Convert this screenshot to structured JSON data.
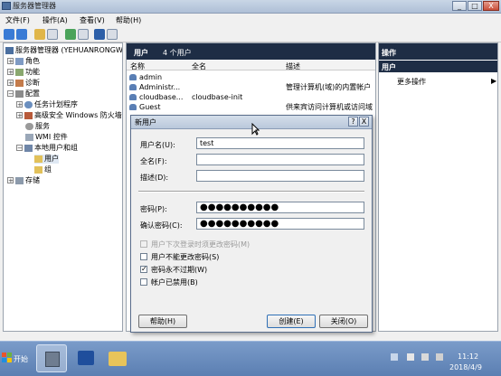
{
  "window": {
    "title": "服务器管理器",
    "controls": [
      "_",
      "□",
      "X"
    ]
  },
  "menu": [
    "文件(F)",
    "操作(A)",
    "查看(V)",
    "帮助(H)"
  ],
  "tree": {
    "root": "服务器管理器 (YEHUANRONGWING",
    "items": [
      "角色",
      "功能",
      "诊断",
      "配置",
      "任务计划程序",
      "高级安全 Windows 防火墙",
      "服务",
      "WMI 控件",
      "本地用户和组",
      "用户",
      "组",
      "存储"
    ]
  },
  "users_pane": {
    "header": "用户",
    "count": "4 个用户",
    "columns": [
      "名称",
      "全名",
      "描述"
    ],
    "rows": [
      {
        "name": "admin",
        "fullname": "",
        "desc": ""
      },
      {
        "name": "Administr...",
        "fullname": "",
        "desc": "管理计算机(域)的内置帐户"
      },
      {
        "name": "cloudbase...",
        "fullname": "cloudbase-init",
        "desc": ""
      },
      {
        "name": "Guest",
        "fullname": "",
        "desc": "供来宾访问计算机或访问域"
      }
    ]
  },
  "actions": {
    "header": "操作",
    "sub": "用户",
    "more": "更多操作",
    "arrow": "▶"
  },
  "dialog": {
    "title": "新用户",
    "help_btn": "?",
    "close_btn": "X",
    "username_label": "用户名(U):",
    "username_value": "test",
    "fullname_label": "全名(F):",
    "fullname_value": "",
    "desc_label": "描述(D):",
    "desc_value": "",
    "password_label": "密码(P):",
    "password_value": "●●●●●●●●●●",
    "confirm_label": "确认密码(C):",
    "confirm_value": "●●●●●●●●●●",
    "checks": [
      {
        "label": "用户下次登录时须更改密码(M)",
        "checked": false,
        "disabled": true,
        "mark": ""
      },
      {
        "label": "用户不能更改密码(S)",
        "checked": false,
        "disabled": false,
        "mark": ""
      },
      {
        "label": "密码永不过期(W)",
        "checked": true,
        "disabled": false,
        "mark": "✓"
      },
      {
        "label": "帐户已禁用(B)",
        "checked": false,
        "disabled": false,
        "mark": ""
      }
    ],
    "btn_help": "帮助(H)",
    "btn_create": "创建(E)",
    "btn_close": "关闭(O)"
  },
  "taskbar": {
    "start": "开始",
    "time": "11:12",
    "date": "2018/4/9"
  }
}
